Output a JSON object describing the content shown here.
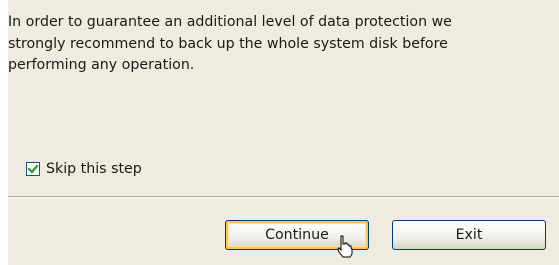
{
  "dialog": {
    "message": "In order to guarantee an additional level of data protection we\nstrongly recommend to back up the whole system disk before\nperforming any operation.",
    "skip_checkbox": {
      "label": "Skip this step",
      "checked": true
    },
    "buttons": {
      "continue_label": "Continue",
      "exit_label": "Exit"
    }
  },
  "icons": {
    "checkmark": "check-icon",
    "cursor": "hand-pointer-icon"
  },
  "colors": {
    "dialog_background": "#efebde",
    "checkmark": "#21a121",
    "default_button_focus": "#f7c35c",
    "button_border": "#003c74"
  }
}
